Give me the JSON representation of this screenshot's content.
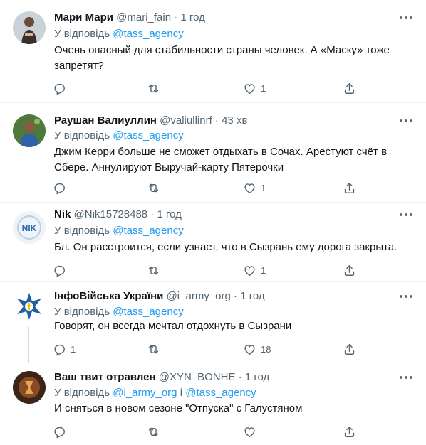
{
  "reply_prefix": "У відповідь",
  "separator": "·",
  "icons": {
    "more": "more-icon",
    "reply": "reply-icon",
    "retweet": "retweet-icon",
    "like": "heart-icon",
    "share": "share-icon"
  },
  "colors": {
    "link": "#1d9bf0",
    "secondary": "#536471",
    "text": "#0f1419",
    "thread_line": "#cfd9de"
  },
  "tweets": [
    {
      "name": "Мари Мари",
      "handle": "@mari_fain",
      "time": "1 год",
      "reply_to_1": "@tass_agency",
      "reply_to_2": "",
      "text": "Очень опасный для стабильности страны человек. А «Маску» тоже запретят?",
      "replies": "",
      "retweets": "",
      "likes": "1"
    },
    {
      "name": "Раушан Валиуллин",
      "handle": "@valiullinrf",
      "time": "43 хв",
      "reply_to_1": "@tass_agency",
      "reply_to_2": "",
      "text": "Джим Керри больше не сможет отдыхать в Сочах. Арестуют счёт в Сбере. Аннулируют Выручай-карту Пятерочки",
      "replies": "",
      "retweets": "",
      "likes": "1"
    },
    {
      "name": "Nik",
      "handle": "@Nik15728488",
      "time": "1 год",
      "reply_to_1": "@tass_agency",
      "reply_to_2": "",
      "text": "Бл. Он расстроится, если узнает, что в Сызрань ему дорога закрыта.",
      "replies": "",
      "retweets": "",
      "likes": "1"
    },
    {
      "name": "ІнфоВійська України",
      "handle": "@i_army_org",
      "time": "1 год",
      "reply_to_1": "@tass_agency",
      "reply_to_2": "",
      "text": "Говорят, он всегда мечтал отдохнуть в Сызрани",
      "replies": "1",
      "retweets": "",
      "likes": "18"
    },
    {
      "name": "Ваш твит отравлен",
      "handle": "@XYN_BONHE",
      "time": "1 год",
      "reply_to_1": "@i_army_org",
      "reply_joiner": "і",
      "reply_to_2": "@tass_agency",
      "text": "И сняться в новом сезоне \"Отпуска\" с Галустяном",
      "replies": "",
      "retweets": "",
      "likes": ""
    }
  ]
}
